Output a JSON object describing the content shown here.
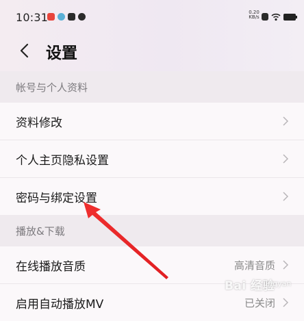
{
  "status_bar": {
    "time": "10:31",
    "net_speed_value": "0.20",
    "net_speed_unit": "KB/s"
  },
  "header": {
    "title": "设置"
  },
  "sections": [
    {
      "title": "帐号与个人资料",
      "items": [
        {
          "label": "资料修改",
          "value": ""
        },
        {
          "label": "个人主页隐私设置",
          "value": ""
        },
        {
          "label": "密码与绑定设置",
          "value": ""
        }
      ]
    },
    {
      "title": "播放&下载",
      "items": [
        {
          "label": "在线播放音质",
          "value": "高清音质"
        },
        {
          "label": "启用自动播放MV",
          "value": "已关闭"
        }
      ]
    }
  ],
  "watermark": {
    "text": "Bai 经验",
    "sub": "jingyan"
  },
  "colors": {
    "annotation_arrow": "#e8262a",
    "section_bg": "#efeaee",
    "row_bg": "#fbf8fa"
  },
  "icons": [
    "app-notification-icon",
    "assistant-icon",
    "message-icon",
    "location-icon",
    "sim-icon",
    "wifi-icon",
    "battery-icon",
    "back-chevron-icon",
    "chevron-right-icon"
  ]
}
